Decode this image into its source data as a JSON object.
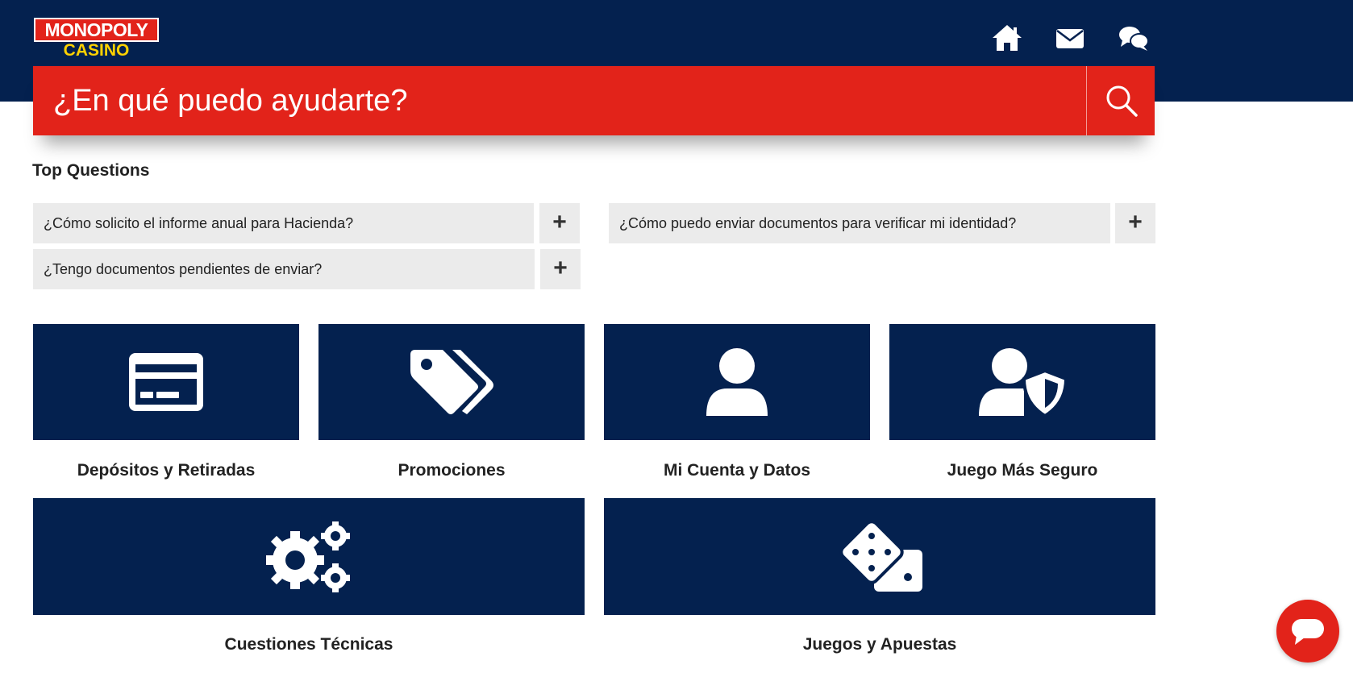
{
  "header": {
    "logo": {
      "line1": "MONOPOLY",
      "line2": "CASINO"
    },
    "icons": [
      "home-icon",
      "mail-icon",
      "chat-icon"
    ]
  },
  "search": {
    "placeholder": "¿En qué puedo ayudarte?",
    "button_icon": "search-icon"
  },
  "top_questions": {
    "title": "Top Questions",
    "items": [
      {
        "question": "¿Cómo solicito el informe anual para Hacienda?",
        "toggle": "+"
      },
      {
        "question": "¿Cómo puedo enviar documentos para verificar mi identidad?",
        "toggle": "+"
      },
      {
        "question": "¿Tengo documentos pendientes de enviar?",
        "toggle": "+"
      }
    ]
  },
  "categories": [
    {
      "label": "Depósitos y Retiradas",
      "icon": "credit-card-icon"
    },
    {
      "label": "Promociones",
      "icon": "tags-icon"
    },
    {
      "label": "Mi Cuenta y Datos",
      "icon": "user-icon"
    },
    {
      "label": "Juego Más Seguro",
      "icon": "user-shield-icon"
    },
    {
      "label": "Cuestiones Técnicas",
      "icon": "gears-icon"
    },
    {
      "label": "Juegos y Apuestas",
      "icon": "dice-icon"
    }
  ],
  "colors": {
    "navy": "#04214f",
    "red": "#e2231a",
    "gold": "#ffd200",
    "faq_bg": "#ebebeb"
  }
}
